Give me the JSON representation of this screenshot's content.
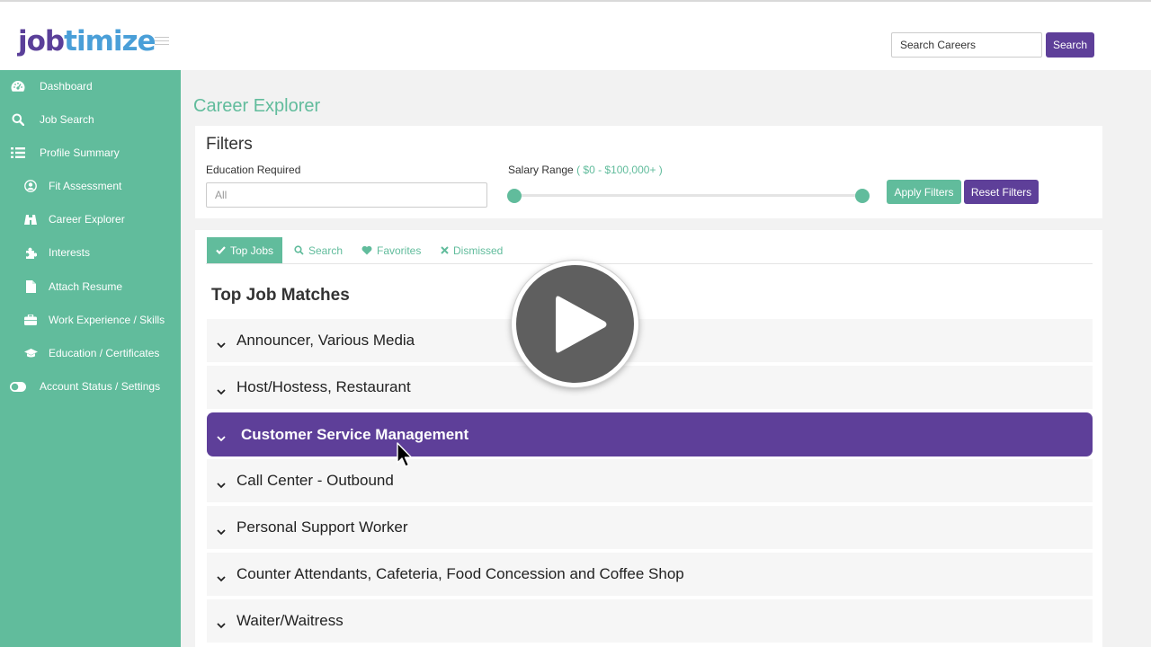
{
  "header": {
    "logo_part1": "job",
    "logo_part2": "timize",
    "search_placeholder": "Search Careers",
    "search_button": "Search"
  },
  "sidebar": {
    "items": [
      {
        "label": "Dashboard",
        "icon": "dashboard-icon"
      },
      {
        "label": "Job Search",
        "icon": "search-icon"
      },
      {
        "label": "Profile Summary",
        "icon": "list-icon"
      },
      {
        "label": "Fit Assessment",
        "icon": "user-circle-icon"
      },
      {
        "label": "Career Explorer",
        "icon": "binoculars-icon"
      },
      {
        "label": "Interests",
        "icon": "puzzle-icon"
      },
      {
        "label": "Attach Resume",
        "icon": "file-icon"
      },
      {
        "label": "Work Experience / Skills",
        "icon": "briefcase-icon"
      },
      {
        "label": "Education / Certificates",
        "icon": "graduation-cap-icon"
      },
      {
        "label": "Account Status / Settings",
        "icon": "toggle-icon"
      }
    ]
  },
  "main": {
    "page_title": "Career Explorer",
    "filters": {
      "title": "Filters",
      "education_label": "Education Required",
      "education_value": "All",
      "salary_label": "Salary Range",
      "salary_range": "( $0 - $100,000+ )",
      "apply_button": "Apply Filters",
      "reset_button": "Reset Filters"
    },
    "tabs": [
      {
        "label": "Top Jobs",
        "icon": "check-icon",
        "active": true
      },
      {
        "label": "Search",
        "icon": "search-icon",
        "active": false
      },
      {
        "label": "Favorites",
        "icon": "heart-icon",
        "active": false
      },
      {
        "label": "Dismissed",
        "icon": "x-icon",
        "active": false
      }
    ],
    "section_title": "Top Job Matches",
    "jobs": [
      "Announcer, Various Media",
      "Host/Hostess, Restaurant",
      "Customer Service Management",
      "Call Center - Outbound",
      "Personal Support Worker",
      "Counter Attendants, Cafeteria, Food Concession and Coffee Shop",
      "Waiter/Waitress"
    ]
  },
  "colors": {
    "green": "#61bc9c",
    "purple": "#5e3f99",
    "logo_blue": "#4a9fd8"
  }
}
